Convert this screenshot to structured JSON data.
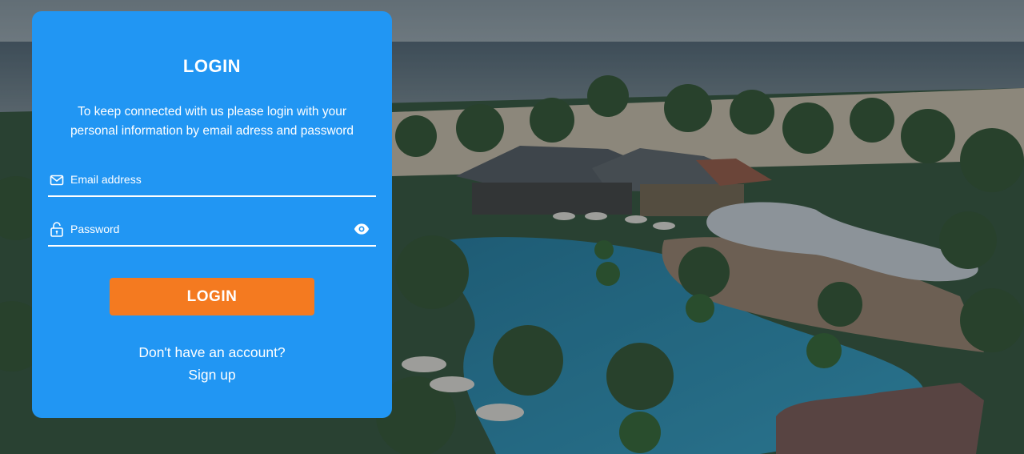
{
  "background": {
    "description_icon": "resort-photo",
    "overlay_color": "#1c2a33"
  },
  "login_card": {
    "title": "LOGIN",
    "description": "To keep connected with us please login with your personal information by email adress and password",
    "email": {
      "icon": "mail-icon",
      "placeholder": "Email address",
      "value": ""
    },
    "password": {
      "icon": "lock-icon",
      "placeholder": "Password",
      "value": "",
      "toggle_icon": "eye-icon"
    },
    "login_button_label": "LOGIN",
    "no_account_text": "Don't have an account?",
    "signup_link": "Sign up",
    "colors": {
      "card": "#2196f3",
      "button": "#f47a20",
      "text": "#ffffff"
    }
  }
}
